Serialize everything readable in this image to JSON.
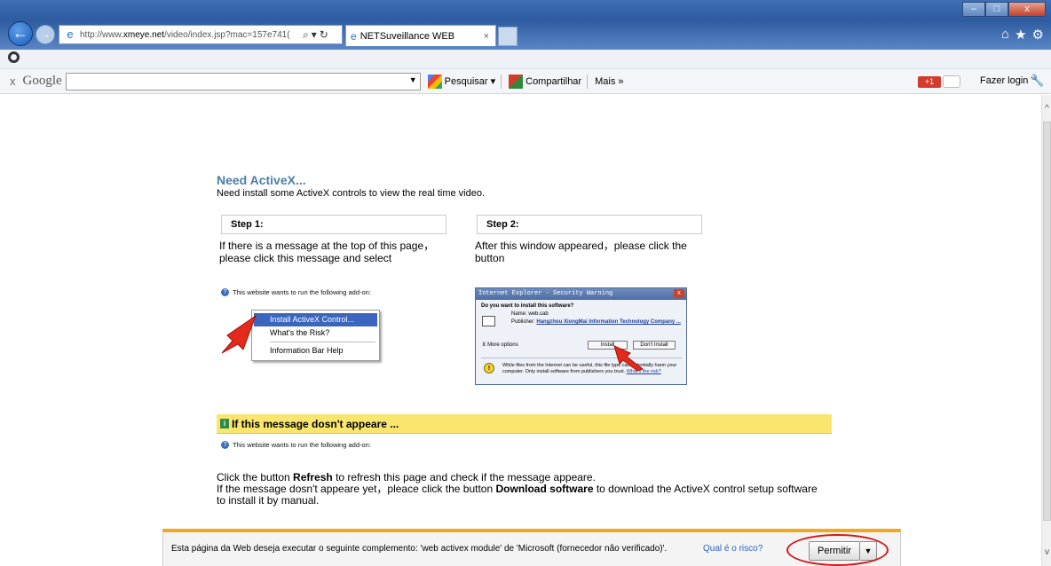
{
  "browser": {
    "address_url_prefix": "http://www.",
    "address_url_host": "xmeye.net",
    "address_url_rest": "/video/index.jsp?mac=157e741(",
    "tab_title": "NETSuveillance WEB",
    "tab_close": "×"
  },
  "google_toolbar": {
    "close": "x",
    "logo": "Google",
    "search_value": "",
    "pesquisar": "Pesquisar",
    "compartilhar": "Compartilhar",
    "mais": "Mais »",
    "gplus": "+1",
    "login": "Fazer login"
  },
  "page": {
    "title": "Need ActiveX...",
    "description": "Need install some ActiveX controls to view the real time video.",
    "step1_label": "Step 1:",
    "step1_text_line1": "If there is a message at the top of this page，",
    "step1_text_line2": "please click this message and select",
    "step2_label": "Step 2:",
    "step2_text_line1": "After this window appeared，please click the",
    "step2_text_line2": "button",
    "addon_message": "This website wants to run the following add-on:",
    "context_menu": {
      "item1": "Install ActiveX Control...",
      "item2": "What's the Risk?",
      "item3": "Information Bar Help"
    },
    "dialog": {
      "title": "Internet Explorer - Security Warning",
      "question": "Do you want to install this software?",
      "name_row": "Name:  web.cab",
      "publisher_label": "Publisher:",
      "publisher_value": "Hangzhou XiongMai Information Technology Company ...",
      "more_options": "More options",
      "install": "Install",
      "dont_install": "Don't Install",
      "warning_text": "While files from the Internet can be useful, this file type can potentially harm your computer. Only install software from publishers you trust.",
      "warning_link": "What's the risk?"
    },
    "yellow_title": "If this message dosn't appeare ...",
    "addon_message2": "This website wants to run the following add-on:",
    "refresh_pre": "Click the button ",
    "refresh_bold": "Refresh",
    "refresh_post": " to refresh this page and check if the message appeare.",
    "download_pre": "If the message dosn't appeare yet，pleace click the button ",
    "download_bold": "Download software",
    "download_post": " to download the ActiveX control setup software",
    "download_line3": "to install it by manual."
  },
  "notification": {
    "text": "Esta página da Web deseja executar o seguinte complemento: 'web activex module' de 'Microsoft (fornecedor não verificado)'.",
    "link": "Qual é o risco?",
    "button": "Permitir"
  },
  "colors": {
    "title_blue": "#4a7fa8",
    "yellow_bar": "#fae66e",
    "notif_border": "#f2a81e",
    "highlight_red": "#d01818"
  }
}
